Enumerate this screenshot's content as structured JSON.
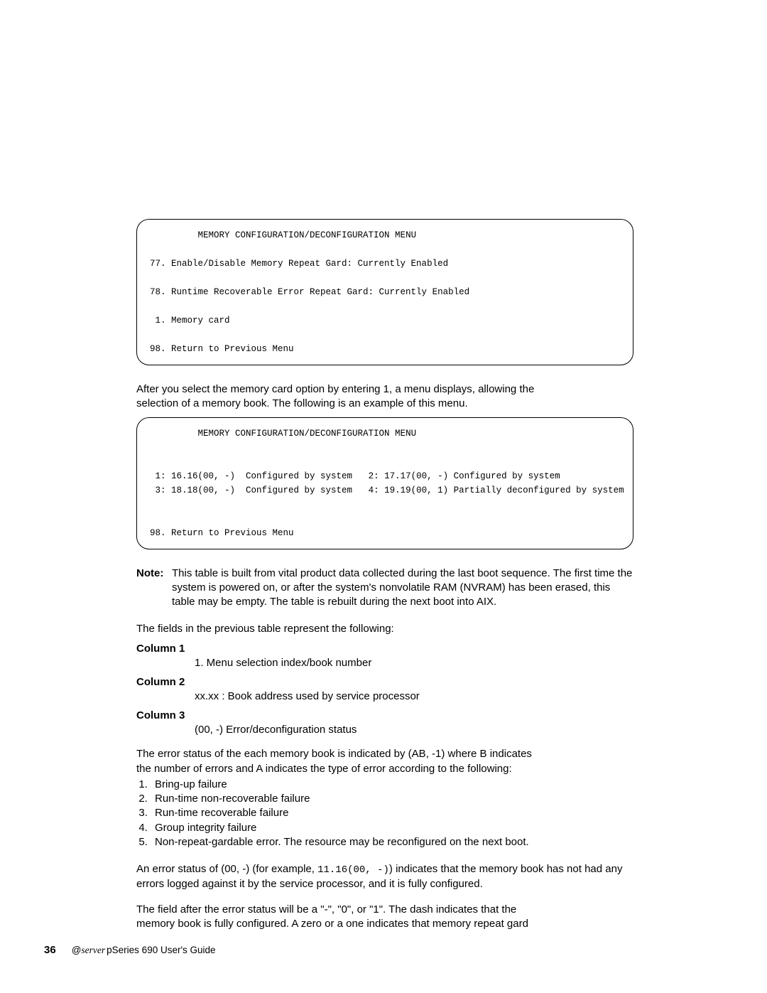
{
  "menu1": {
    "title": "MEMORY CONFIGURATION/DECONFIGURATION MENU",
    "items": [
      "77. Enable/Disable Memory Repeat Gard: Currently Enabled",
      "78. Runtime Recoverable Error Repeat Gard: Currently Enabled",
      " 1. Memory card",
      "98. Return to Previous Menu"
    ]
  },
  "para_after_menu1_a": "After you select the memory card option by entering 1, a menu displays, allowing the",
  "para_after_menu1_b": "selection of a memory book. The following is an example of this menu.",
  "menu2": {
    "title": "MEMORY CONFIGURATION/DECONFIGURATION MENU",
    "row1_a": " 1: 16.16(00, -)  Configured by system",
    "row1_b": "2: 17.17(00, -) Configured by system",
    "row2_a": " 3: 18.18(00, -)  Configured by system",
    "row2_b": "4: 19.19(00, 1) Partially deconfigured by system",
    "return": "98. Return to Previous Menu"
  },
  "note": {
    "label": "Note:",
    "text": "This table is built from vital product data collected during the last boot sequence. The first time the system is powered on, or after the system's nonvolatile RAM (NVRAM) has been erased, this table may be empty. The table is rebuilt during the next boot into AIX."
  },
  "fields_intro": "The fields in the previous table represent the following:",
  "columns": [
    {
      "label": "Column 1",
      "desc": "1. Menu selection index/book number"
    },
    {
      "label": "Column 2",
      "desc": "xx.xx : Book address used by service processor"
    },
    {
      "label": "Column 3",
      "desc": "(00, -) Error/deconfiguration status"
    }
  ],
  "error_status_intro_a": "The error status of the each memory book is indicated by (AB, -1) where B indicates",
  "error_status_intro_b": "the number of errors and A indicates the type of error according to the following:",
  "error_list": [
    "Bring-up failure",
    "Run-time non-recoverable failure",
    "Run-time recoverable failure",
    "Group integrity failure",
    "Non-repeat-gardable error. The resource may be reconfigured on the next boot."
  ],
  "status00": {
    "pre": "An error status of (00, -) (for example, ",
    "code": "11.16(00, -)",
    "post": ") indicates that the memory book has not had any errors logged against it by the service processor, and it is fully configured."
  },
  "field_after_a": "The field after the error status will be a \"-\", \"0\", or \"1\". The dash indicates that the",
  "field_after_b": "memory book is fully configured. A zero or a one indicates that memory repeat gard",
  "footer": {
    "page_number": "36",
    "brand_prefix": "e",
    "brand": "server",
    "title": " pSeries 690 User's Guide"
  }
}
